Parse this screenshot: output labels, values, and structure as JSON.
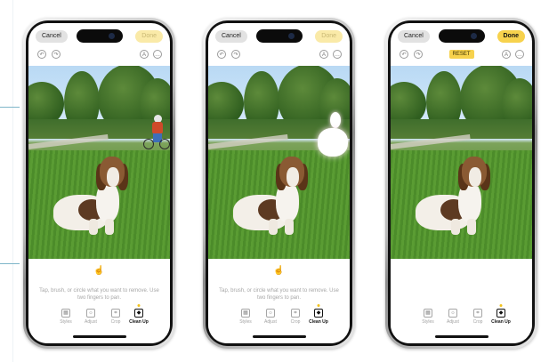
{
  "screens": [
    {
      "cancel": "Cancel",
      "done": "Done",
      "done_state": "disabled",
      "hint": "Tap, brush, or circle what you want to remove. Use two fingers to pan.",
      "tools": [
        "Styles",
        "Adjust",
        "Crop",
        "Clean Up"
      ],
      "active_tool": "Clean Up"
    },
    {
      "cancel": "Cancel",
      "done": "Done",
      "done_state": "disabled",
      "hint": "Tap, brush, or circle what you want to remove. Use two fingers to pan.",
      "tools": [
        "Styles",
        "Adjust",
        "Crop",
        "Clean Up"
      ],
      "active_tool": "Clean Up"
    },
    {
      "cancel": "Cancel",
      "done": "Done",
      "done_state": "enabled",
      "reset": "RESET",
      "tools": [
        "Styles",
        "Adjust",
        "Crop",
        "Clean Up"
      ],
      "active_tool": "Clean Up"
    }
  ],
  "icons": {
    "undo": "undo-icon",
    "redo": "redo-icon",
    "markup": "markup-icon",
    "more": "more-icon",
    "hand": "hand-pointer-icon",
    "clean_up": "eraser-icon"
  },
  "colors": {
    "done_active": "#f7d24d",
    "done_inactive": "#faeaa8",
    "reset_bg": "#f7d24d",
    "grass": "#4f8b2b"
  }
}
